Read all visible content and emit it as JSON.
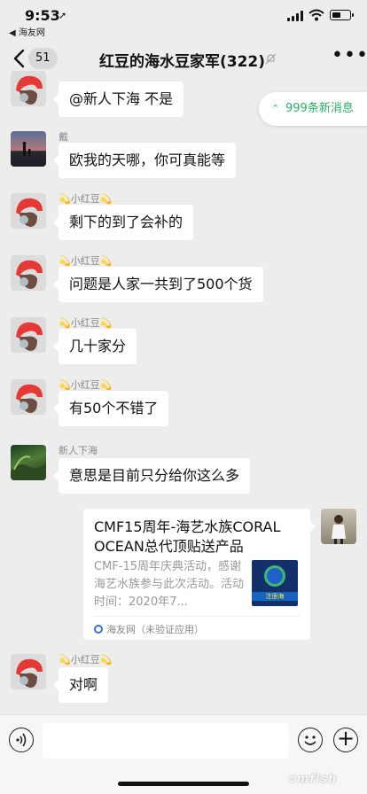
{
  "status_bar": {
    "time": "9:53",
    "back_app": "◀ 海友网"
  },
  "nav": {
    "unread_count": "51",
    "title": "红豆的海水豆家军(322)"
  },
  "new_messages_pill": "999条新消息",
  "messages": [
    {
      "sender": "",
      "text": "@新人下海 不是",
      "avatar": "red-hat-avatar"
    },
    {
      "sender": "戴",
      "text": "欧我的天哪，你可真能等",
      "avatar": "sunset-avatar"
    },
    {
      "sender": "💫小红豆💫",
      "text": "剩下的到了会补的",
      "avatar": "red-hat-avatar"
    },
    {
      "sender": "💫小红豆💫",
      "text": "问题是人家一共到了500个货",
      "avatar": "red-hat-avatar"
    },
    {
      "sender": "💫小红豆💫",
      "text": "几十家分",
      "avatar": "red-hat-avatar"
    },
    {
      "sender": "💫小红豆💫",
      "text": "有50个不错了",
      "avatar": "red-hat-avatar"
    },
    {
      "sender": "新人下海",
      "text": "意思是目前只分给你这么多",
      "avatar": "aquarium-avatar"
    },
    {
      "sender": "💫小红豆💫",
      "text": "对啊",
      "avatar": "red-hat-avatar"
    }
  ],
  "shared_card": {
    "title": "CMF15周年-海艺水族CORAL OCEAN总代顶贴送产品",
    "description": "CMF-15周年庆典活动，感谢海艺水族参与此次活动。活动时间：2020年7...",
    "source": "海友网（未验证应用）",
    "thumb_label": "注册海"
  },
  "watermark": "cmfish"
}
